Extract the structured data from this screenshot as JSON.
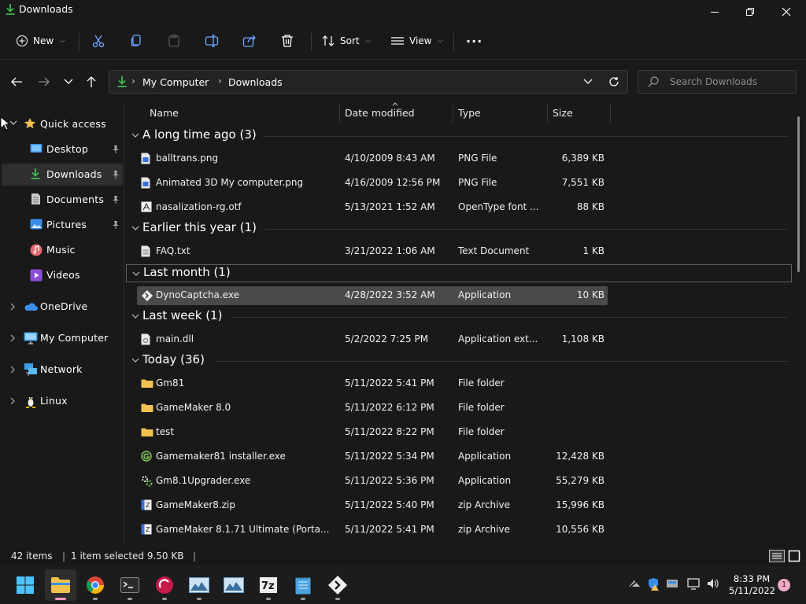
{
  "window": {
    "title": "Downloads"
  },
  "toolbar": {
    "new_label": "New",
    "sort_label": "Sort",
    "view_label": "View",
    "more_label": "..."
  },
  "address": {
    "crumbs": [
      "My Computer",
      "Downloads"
    ],
    "search_placeholder": "Search Downloads"
  },
  "sidebar": {
    "quick_access": "Quick access",
    "items": [
      {
        "label": "Desktop",
        "icon": "desktop-icon",
        "pinned": true
      },
      {
        "label": "Downloads",
        "icon": "download-icon",
        "pinned": true,
        "selected": true
      },
      {
        "label": "Documents",
        "icon": "document-icon",
        "pinned": true
      },
      {
        "label": "Pictures",
        "icon": "picture-icon",
        "pinned": true
      },
      {
        "label": "Music",
        "icon": "music-icon"
      },
      {
        "label": "Videos",
        "icon": "video-icon"
      }
    ],
    "locations": [
      {
        "label": "OneDrive",
        "icon": "cloud-icon"
      },
      {
        "label": "My Computer",
        "icon": "computer-icon"
      },
      {
        "label": "Network",
        "icon": "network-icon"
      },
      {
        "label": "Linux",
        "icon": "linux-icon"
      }
    ]
  },
  "columns": {
    "name": "Name",
    "date": "Date modified",
    "type": "Type",
    "size": "Size"
  },
  "groups": [
    {
      "label": "A long time ago (3)"
    },
    {
      "label": "Earlier this year (1)"
    },
    {
      "label": "Last month (1)"
    },
    {
      "label": "Last week (1)"
    },
    {
      "label": "Today (36)"
    }
  ],
  "files": [
    {
      "name": "balltrans.png",
      "date": "4/10/2009 8:43 AM",
      "type": "PNG File",
      "size": "6,389 KB",
      "icon": "image-file-icon"
    },
    {
      "name": "Animated 3D My computer.png",
      "date": "4/16/2009 12:56 PM",
      "type": "PNG File",
      "size": "7,551 KB",
      "icon": "image-file-icon"
    },
    {
      "name": "nasalization-rg.otf",
      "date": "5/13/2021 1:52 AM",
      "type": "OpenType font ...",
      "size": "88 KB",
      "icon": "font-file-icon"
    },
    {
      "name": "FAQ.txt",
      "date": "3/21/2022 1:06 AM",
      "type": "Text Document",
      "size": "1 KB",
      "icon": "text-file-icon"
    },
    {
      "name": "DynoCaptcha.exe",
      "date": "4/28/2022 3:52 AM",
      "type": "Application",
      "size": "10 KB",
      "icon": "app-icon",
      "selected": true
    },
    {
      "name": "main.dll",
      "date": "5/2/2022 7:25 PM",
      "type": "Application ext...",
      "size": "1,108 KB",
      "icon": "dll-file-icon"
    },
    {
      "name": "Gm81",
      "date": "5/11/2022 5:41 PM",
      "type": "File folder",
      "size": "",
      "icon": "folder-icon"
    },
    {
      "name": "GameMaker 8.0",
      "date": "5/11/2022 6:12 PM",
      "type": "File folder",
      "size": "",
      "icon": "folder-icon"
    },
    {
      "name": "test",
      "date": "5/11/2022 8:22 PM",
      "type": "File folder",
      "size": "",
      "icon": "folder-icon"
    },
    {
      "name": "Gamemaker81 installer.exe",
      "date": "5/11/2022 5:34 PM",
      "type": "Application",
      "size": "12,428 KB",
      "icon": "installer-icon"
    },
    {
      "name": "Gm8.1Upgrader.exe",
      "date": "5/11/2022 5:36 PM",
      "type": "Application",
      "size": "55,279 KB",
      "icon": "gear-app-icon"
    },
    {
      "name": "GameMaker8.zip",
      "date": "5/11/2022 5:40 PM",
      "type": "zip Archive",
      "size": "15,996 KB",
      "icon": "zip-file-icon"
    },
    {
      "name": "GameMaker 8.1.71 Ultimate (Porta...",
      "date": "5/11/2022 5:41 PM",
      "type": "zip Archive",
      "size": "10,556 KB",
      "icon": "zip-file-icon"
    }
  ],
  "status": {
    "count": "42 items",
    "selected": "1 item selected  9.50 KB"
  },
  "taskbar": {
    "apps": [
      "start-icon",
      "file-explorer-icon",
      "chrome-icon",
      "terminal-icon",
      "raspberry-icon",
      "photos-icon",
      "photos-icon",
      "7zip-icon",
      "notepad-icon",
      "dynocaptcha-icon"
    ],
    "time": "8:33 PM",
    "date": "5/11/2022",
    "notifications": "1"
  },
  "colors": {
    "folder": "#f2c14e",
    "accent_green": "#3fb950",
    "selection": "#4a4a4a",
    "badge": "#f3a9c8"
  }
}
